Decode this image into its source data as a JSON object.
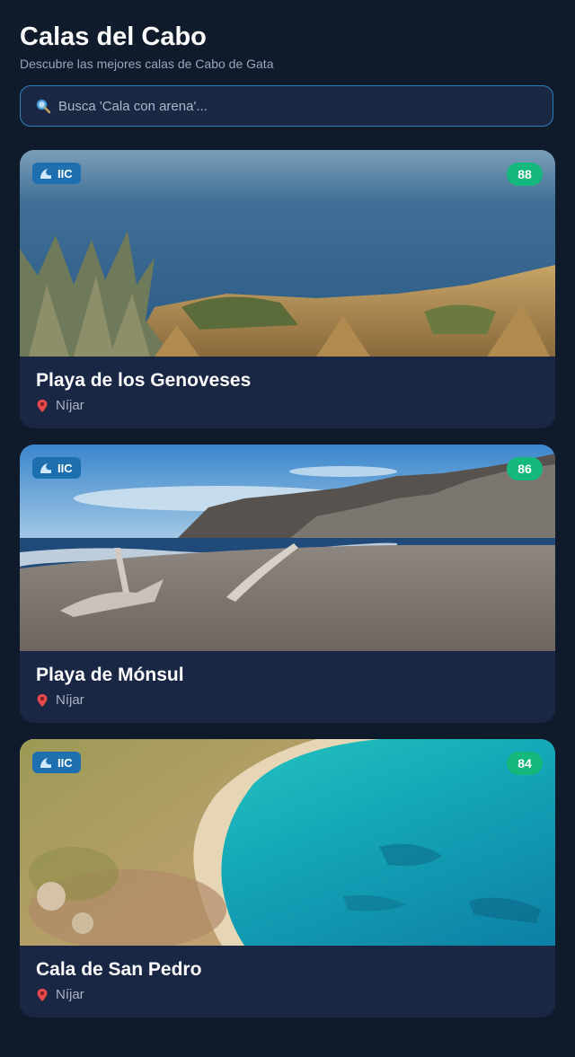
{
  "header": {
    "title": "Calas del Cabo",
    "subtitle": "Descubre las mejores calas de Cabo de Gata"
  },
  "search": {
    "placeholder": "Busca 'Cala con arena'...",
    "icon": "search-icon"
  },
  "colors": {
    "background": "#0f1b2b",
    "card": "#1a2744",
    "badge": "#1d6fb0",
    "score": "#15b87c",
    "search_border": "#2f7fbf"
  },
  "beaches": [
    {
      "name": "Playa de los Genoveses",
      "location": "Níjar",
      "badge": "IIC",
      "score": "88",
      "image": "coastal-grass-view"
    },
    {
      "name": "Playa de Mónsul",
      "location": "Níjar",
      "badge": "IIC",
      "score": "86",
      "image": "driftwood-beach-cliffs"
    },
    {
      "name": "Cala de San Pedro",
      "location": "Níjar",
      "badge": "IIC",
      "score": "84",
      "image": "turquoise-cove-aerial"
    }
  ]
}
